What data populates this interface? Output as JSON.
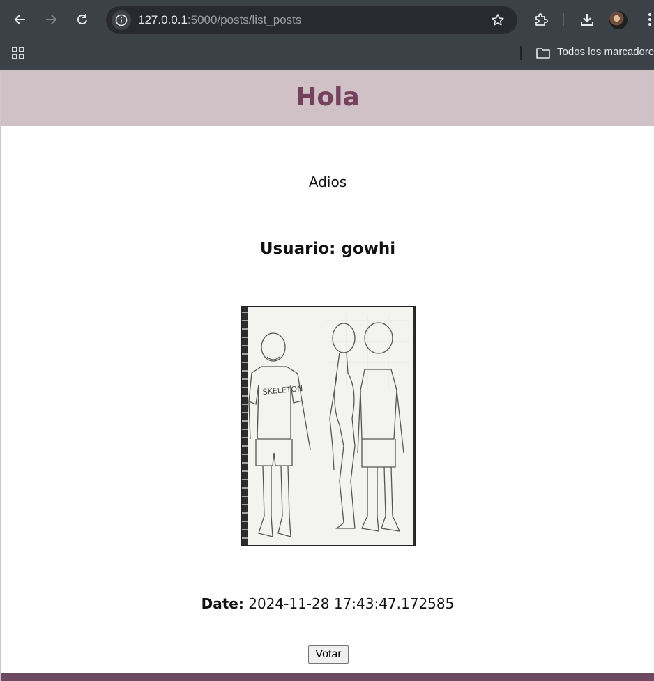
{
  "browser": {
    "url_host": "127.0.0.1",
    "url_rest": ":5000/posts/list_posts",
    "bookmarks_label": "Todos los marcadores"
  },
  "page": {
    "title": "Hola",
    "subtitle": "Adios",
    "user_line": "Usuario: gowhi",
    "date_label": "Date:",
    "date_value": "2024-11-28 17:43:47.172585",
    "vote_button": "Votar"
  },
  "colors": {
    "chrome_bg": "#3c4047",
    "banner_bg": "#d0c1c6",
    "title_color": "#74425f",
    "footer_bar": "#6e4a62"
  },
  "image": {
    "text_in_drawing": "SKELETON"
  }
}
